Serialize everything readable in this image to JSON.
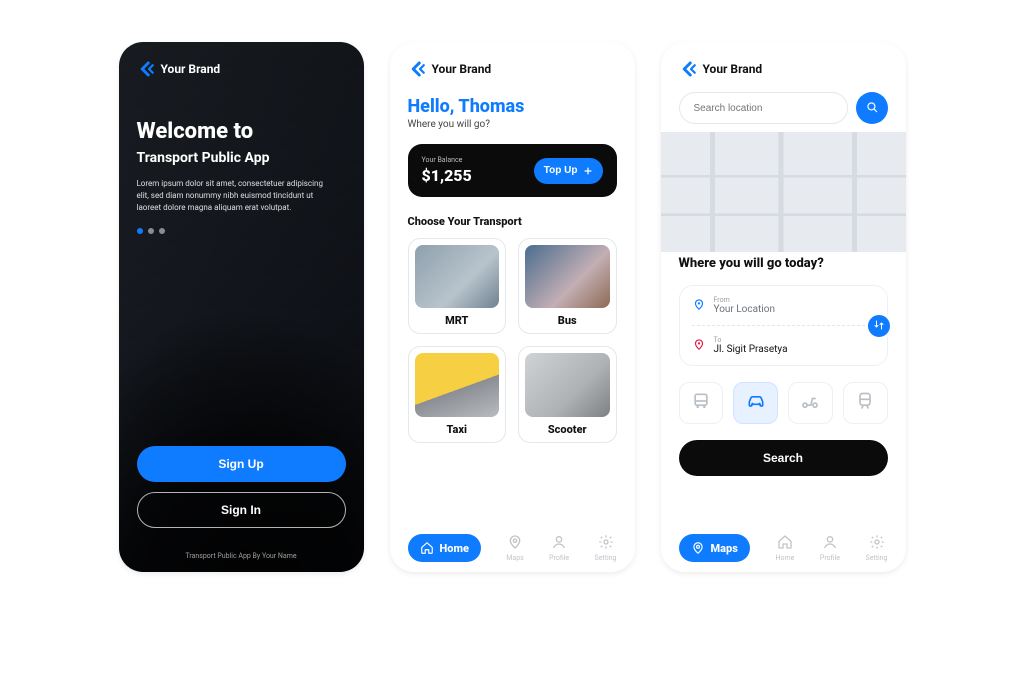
{
  "brand": {
    "name": "Your Brand"
  },
  "onboarding": {
    "headline": "Welcome to",
    "subhead": "Transport Public App",
    "lorem": "Lorem ipsum dolor sit amet, consectetuer adipiscing elit, sed diam nonummy nibh euismod tincidunt ut laoreet dolore magna aliquam erat volutpat.",
    "signup": "Sign Up",
    "signin": "Sign In",
    "footer": "Transport Public App By Your Name"
  },
  "home": {
    "hello": "Hello, Thomas",
    "sub": "Where you will go?",
    "balance_label": "Your Balance",
    "balance_amount": "$1,255",
    "topup": "Top Up",
    "choose": "Choose Your Transport",
    "cards": {
      "mrt": "MRT",
      "bus": "Bus",
      "taxi": "Taxi",
      "scooter": "Scooter"
    },
    "nav": {
      "home": "Home",
      "maps": "Maps",
      "profile": "Profile",
      "setting": "Setting"
    }
  },
  "maps": {
    "search_placeholder": "Search location",
    "sheet_title": "Where you will go today?",
    "from_label": "From",
    "from_value": "Your Location",
    "to_label": "To",
    "to_value": "Jl. Sigit Prasetya",
    "search_btn": "Search",
    "nav": {
      "maps": "Maps",
      "home": "Home",
      "profile": "Profile",
      "setting": "Setting"
    }
  }
}
